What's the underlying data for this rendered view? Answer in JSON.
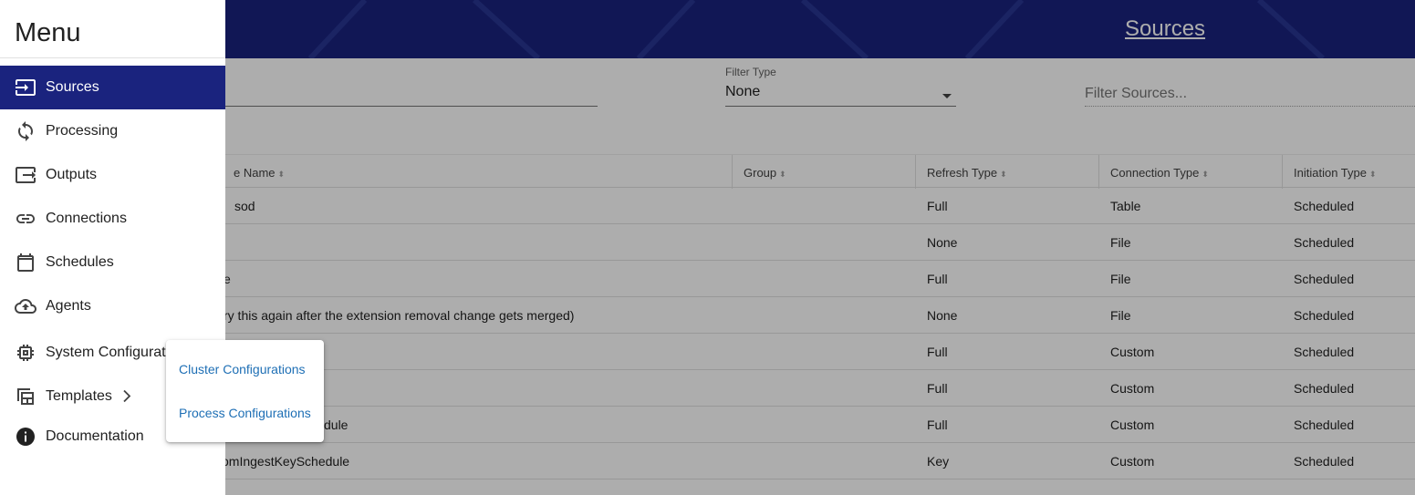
{
  "header": {
    "title": "Sources"
  },
  "filters": {
    "filter_type_label": "Filter Type",
    "filter_type_value": "None",
    "filter_placeholder": "Filter Sources..."
  },
  "table": {
    "headers": [
      "e Name",
      "Group",
      "Refresh Type",
      "Connection Type",
      "Initiation Type"
    ],
    "rows": [
      {
        "name": "sod",
        "group": "",
        "refresh": "Full",
        "connection": "Table",
        "initiation": "Scheduled"
      },
      {
        "name": "",
        "group": "",
        "refresh": "None",
        "connection": "File",
        "initiation": "Scheduled"
      },
      {
        "name": "e",
        "group": "",
        "refresh": "Full",
        "connection": "File",
        "initiation": "Scheduled"
      },
      {
        "name": "ry this again after the extension removal change gets merged)",
        "group": "",
        "refresh": "None",
        "connection": "File",
        "initiation": "Scheduled"
      },
      {
        "name": "",
        "group": "",
        "refresh": "Full",
        "connection": "Custom",
        "initiation": "Scheduled"
      },
      {
        "name": "",
        "group": "",
        "refresh": "Full",
        "connection": "Custom",
        "initiation": "Scheduled"
      },
      {
        "name": "dule",
        "group": "",
        "refresh": "Full",
        "connection": "Custom",
        "initiation": "Scheduled"
      },
      {
        "name": "omIngestKeySchedule",
        "group": "",
        "refresh": "Key",
        "connection": "Custom",
        "initiation": "Scheduled"
      }
    ]
  },
  "menu": {
    "title": "Menu",
    "items": [
      {
        "label": "Sources",
        "icon": "source-input-icon",
        "active": true
      },
      {
        "label": "Processing",
        "icon": "sync-icon"
      },
      {
        "label": "Outputs",
        "icon": "output-icon"
      },
      {
        "label": "Connections",
        "icon": "link-icon"
      },
      {
        "label": "Schedules",
        "icon": "calendar-icon"
      },
      {
        "label": "Agents",
        "icon": "cloud-upload-icon"
      },
      {
        "label": "System Configurat",
        "icon": "chip-icon"
      },
      {
        "label": "Templates",
        "icon": "template-icon",
        "has_submenu": true
      },
      {
        "label": "Documentation",
        "icon": "info-icon"
      }
    ]
  },
  "submenu": {
    "items": [
      "Cluster Configurations",
      "Process Configurations"
    ]
  },
  "colors": {
    "primary": "#1a237e",
    "link": "#1e6fb5"
  }
}
